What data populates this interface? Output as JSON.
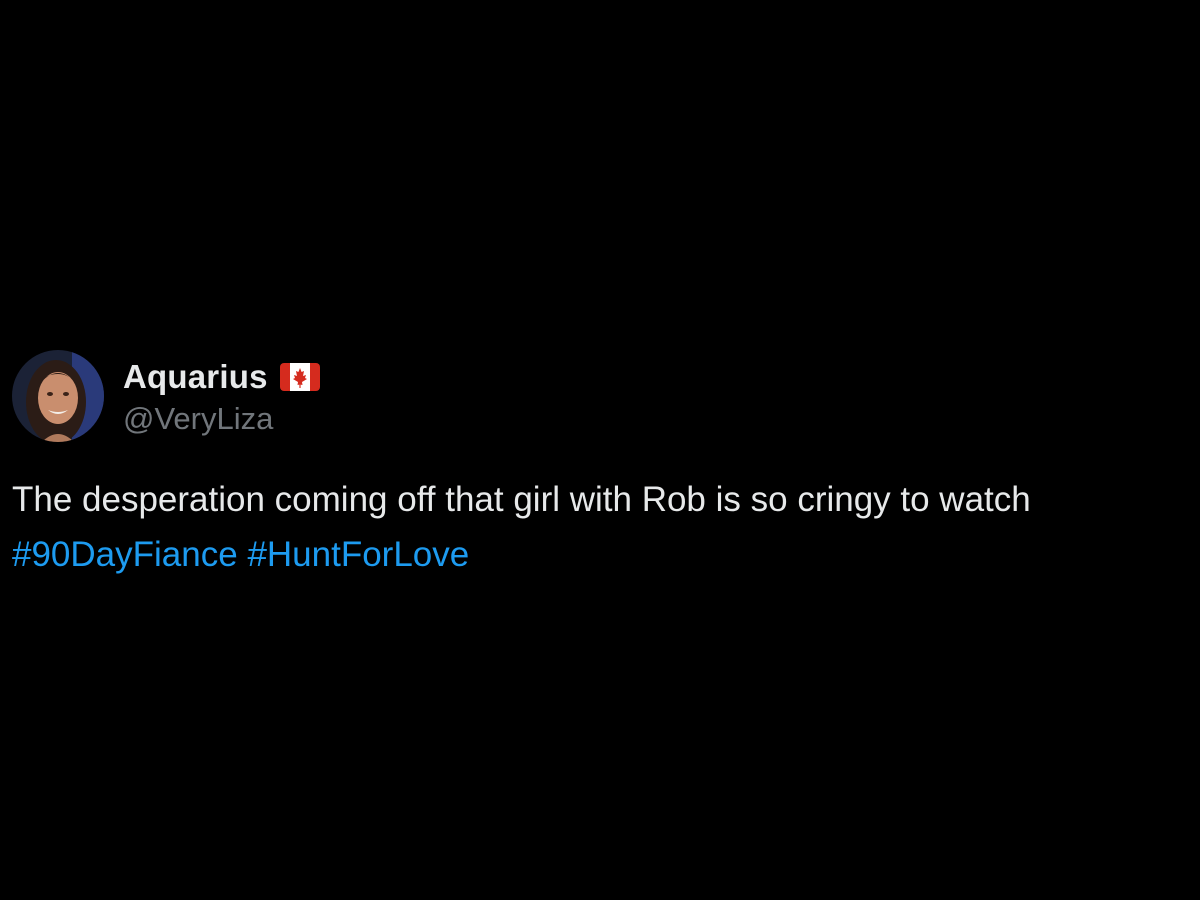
{
  "tweet": {
    "author": {
      "display_name": "Aquarius",
      "flag_icon": "canada-flag-icon",
      "handle": "@VeryLiza"
    },
    "text": "The desperation coming off that girl with Rob is so cringy to watch",
    "hashtags": [
      "#90DayFiance",
      "#HuntForLove"
    ]
  },
  "colors": {
    "background": "#000000",
    "primary_text": "#e7e9ea",
    "secondary_text": "#71767b",
    "link": "#1d9bf0"
  }
}
